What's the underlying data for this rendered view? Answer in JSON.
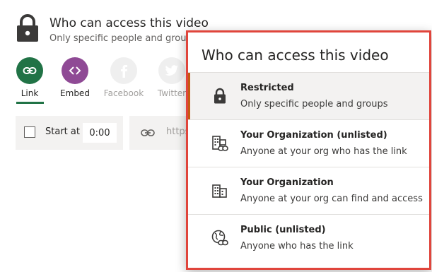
{
  "header": {
    "title": "Who can access this video",
    "subtitle": "Only specific people and groups",
    "icon": "lock-icon"
  },
  "share_buttons": [
    {
      "label": "Link",
      "icon": "link-icon",
      "color": "#217346",
      "active": true
    },
    {
      "label": "Embed",
      "icon": "embed-code-icon",
      "color": "#8f4a95",
      "active": false
    },
    {
      "label": "Facebook",
      "icon": "facebook-icon",
      "color": "#efefef",
      "active": false
    },
    {
      "label": "Twitter",
      "icon": "twitter-icon",
      "color": "#efefef",
      "active": false
    }
  ],
  "start_at": {
    "label": "Start at",
    "value": "0:00",
    "checked": false
  },
  "url": {
    "text": "https:"
  },
  "dropdown": {
    "title": "Who can access this video",
    "options": [
      {
        "title": "Restricted",
        "subtitle": "Only specific people and groups",
        "icon": "lock-icon",
        "selected": true
      },
      {
        "title": "Your Organization (unlisted)",
        "subtitle": "Anyone at your org who has the link",
        "icon": "organization-link-icon",
        "selected": false
      },
      {
        "title": "Your Organization",
        "subtitle": "Anyone at your org can find and access",
        "icon": "organization-icon",
        "selected": false
      },
      {
        "title": "Public (unlisted)",
        "subtitle": "Anyone who has the link",
        "icon": "globe-link-icon",
        "selected": false
      }
    ]
  },
  "colors": {
    "accent_green": "#217346",
    "embed_purple": "#8f4a95",
    "selected_bar": "#c55a11",
    "highlight_border": "#e0453c"
  }
}
